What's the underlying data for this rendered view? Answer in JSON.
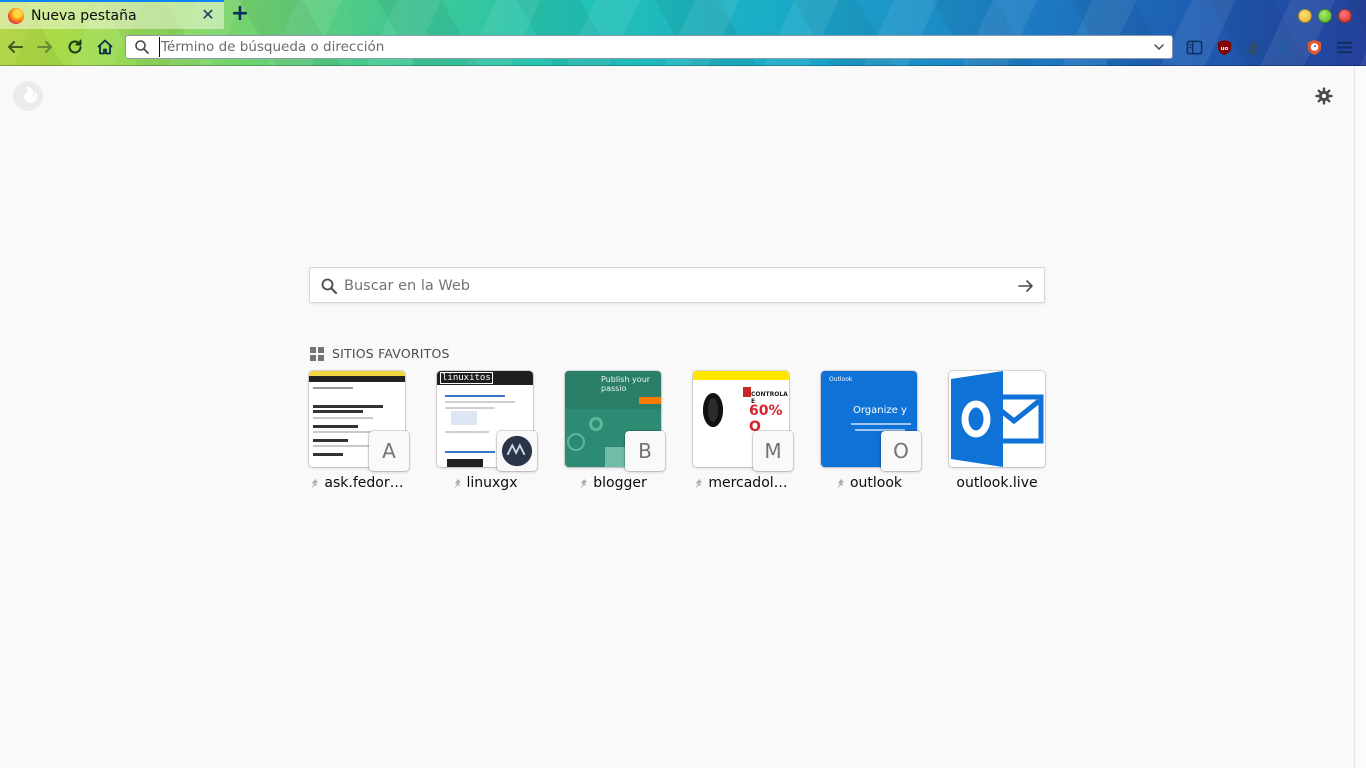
{
  "tab": {
    "title": "Nueva pestaña"
  },
  "urlbar": {
    "placeholder": "Término de búsqueda o dirección",
    "value": ""
  },
  "search": {
    "placeholder": "Buscar en la Web"
  },
  "topsites": {
    "heading": "SITIOS FAVORITOS",
    "items": [
      {
        "label": "ask.fedor…",
        "letter": "A"
      },
      {
        "label": "linuxgx",
        "letter": ""
      },
      {
        "label": "blogger",
        "letter": "B"
      },
      {
        "label": "mercadol…",
        "letter": "M"
      },
      {
        "label": "outlook",
        "letter": "O"
      },
      {
        "label": "outlook.live",
        "letter": ""
      }
    ]
  },
  "thumbs": {
    "linuxgx_header": "linuxitos",
    "blogger_text": "Publish your passio",
    "mercadolibre_ctl": "CONTROLA E",
    "mercadolibre_pct": "60% O",
    "outlook_small": "Outlook",
    "outlook_headline": "Organize y"
  },
  "colors": {
    "accent": "#0a84ff",
    "outlook_blue": "#0f72d6",
    "blogger_green": "#2e8b73",
    "mercadolibre_yellow": "#ffe600"
  }
}
